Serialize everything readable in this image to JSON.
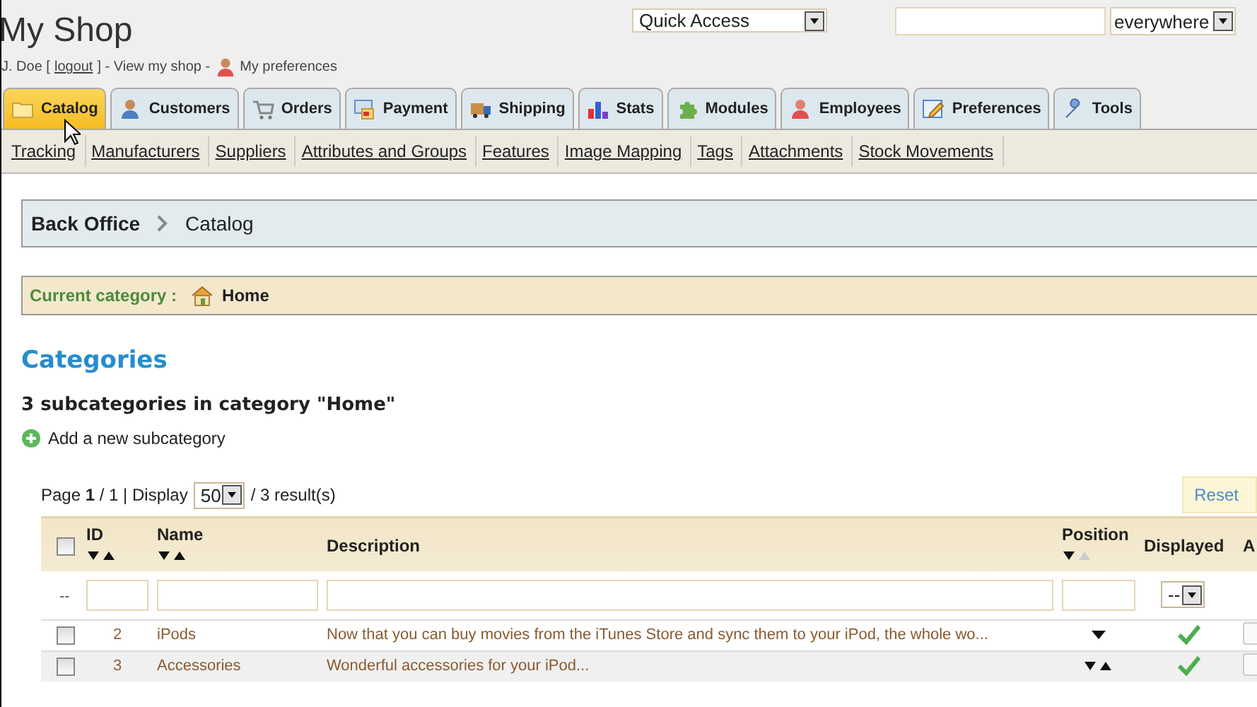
{
  "header": {
    "title": "My Shop",
    "user_prefix": "J. Doe [",
    "logout": "logout",
    "user_middle": "] - View my shop -",
    "preferences": "My preferences",
    "quick_access": "Quick Access",
    "search_scope": "everywhere"
  },
  "tabs": [
    {
      "label": "Catalog",
      "selected": true
    },
    {
      "label": "Customers",
      "selected": false
    },
    {
      "label": "Orders",
      "selected": false
    },
    {
      "label": "Payment",
      "selected": false
    },
    {
      "label": "Shipping",
      "selected": false
    },
    {
      "label": "Stats",
      "selected": false
    },
    {
      "label": "Modules",
      "selected": false
    },
    {
      "label": "Employees",
      "selected": false
    },
    {
      "label": "Preferences",
      "selected": false
    },
    {
      "label": "Tools",
      "selected": false
    }
  ],
  "subnav": [
    "Tracking",
    "Manufacturers",
    "Suppliers",
    "Attributes and Groups",
    "Features",
    "Image Mapping",
    "Tags",
    "Attachments",
    "Stock Movements"
  ],
  "breadcrumb": [
    "Back Office",
    "Catalog"
  ],
  "current_category": {
    "label": "Current category :",
    "value": "Home"
  },
  "section_title": "Categories",
  "subtitle": "3 subcategories in category \"Home\"",
  "add_link": "Add a new subcategory",
  "pagination": {
    "text": "Page **1** / 1 | Display",
    "per_page": "50",
    "results": "/ 3 result(s)",
    "reset": "Reset"
  },
  "table": {
    "select_all_checked": false,
    "columns": [
      {
        "label": "ID",
        "asc_enabled": true
      },
      {
        "label": "Name",
        "asc_enabled": true
      },
      {
        "label": "Description"
      },
      {
        "label": "Position",
        "asc_enabled": false
      },
      {
        "label": "Displayed"
      },
      {
        "label": "A"
      }
    ],
    "filter": {
      "select_all": "--",
      "displayed": "--"
    },
    "rows": [
      {
        "checked": false,
        "id": "2",
        "name": "iPods",
        "description": "Now that you can buy movies from the iTunes Store and sync them to your iPod, the whole wo...",
        "can_move_down": true,
        "can_move_up": false,
        "displayed": true
      },
      {
        "checked": false,
        "id": "3",
        "name": "Accessories",
        "description": "Wonderful accessories for your iPod...",
        "can_move_down": true,
        "can_move_up": true,
        "displayed": true
      }
    ]
  }
}
